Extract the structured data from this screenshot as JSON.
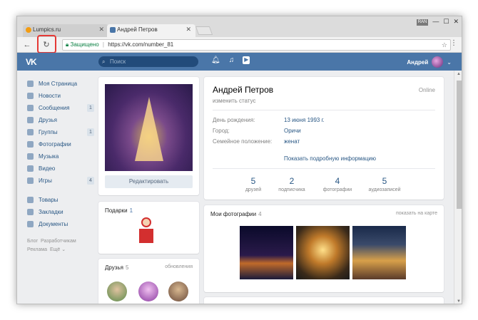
{
  "browser": {
    "tabs": [
      {
        "title": "Lumpics.ru",
        "active": false,
        "favicon_color": "#f39c12"
      },
      {
        "title": "Андрей Петров",
        "active": true,
        "favicon_color": "#4a76a8"
      }
    ],
    "lang_badge": "RAN",
    "secure_label": "Защищено",
    "url": "https://vk.com/number_81",
    "reload_highlight_color": "#e53935"
  },
  "vk": {
    "logo": "VK",
    "search_placeholder": "Поиск",
    "user_name": "Андрей"
  },
  "sidebar": {
    "items": [
      {
        "label": "Моя Страница",
        "badge": ""
      },
      {
        "label": "Новости",
        "badge": ""
      },
      {
        "label": "Сообщения",
        "badge": "1"
      },
      {
        "label": "Друзья",
        "badge": ""
      },
      {
        "label": "Группы",
        "badge": "1"
      },
      {
        "label": "Фотографии",
        "badge": ""
      },
      {
        "label": "Музыка",
        "badge": ""
      },
      {
        "label": "Видео",
        "badge": ""
      },
      {
        "label": "Игры",
        "badge": "4"
      }
    ],
    "items2": [
      {
        "label": "Товары"
      },
      {
        "label": "Закладки"
      },
      {
        "label": "Документы"
      }
    ],
    "footer": {
      "blog": "Блог",
      "devs": "Разработчикам",
      "ads": "Реклама",
      "more": "Ещё ⌄"
    }
  },
  "avatar": {
    "edit_label": "Редактировать"
  },
  "gifts": {
    "title": "Подарки",
    "count": "1"
  },
  "friends": {
    "title": "Друзья",
    "count": "5",
    "updates": "обновления"
  },
  "profile": {
    "name": "Андрей Петров",
    "status": "изменить статус",
    "online": "Online",
    "birthday_label": "День рождения:",
    "birthday": "13 июня 1993 г.",
    "city_label": "Город:",
    "city": "Оричи",
    "family_label": "Семейное положение:",
    "family": "женат",
    "more": "Показать подробную информацию",
    "stats": [
      {
        "n": "5",
        "label": "друзей"
      },
      {
        "n": "2",
        "label": "подписчика"
      },
      {
        "n": "4",
        "label": "фотографии"
      },
      {
        "n": "5",
        "label": "аудиозаписей"
      }
    ]
  },
  "photos": {
    "title": "Мои фотографии",
    "count": "4",
    "map_link": "показать на карте"
  }
}
